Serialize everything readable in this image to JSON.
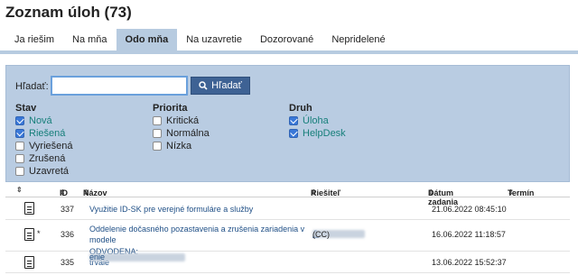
{
  "page": {
    "title": "Zoznam úloh (73)"
  },
  "tabs": [
    {
      "label": "Ja riešim",
      "active": false
    },
    {
      "label": "Na mňa",
      "active": false
    },
    {
      "label": "Odo mňa",
      "active": true
    },
    {
      "label": "Na uzavretie",
      "active": false
    },
    {
      "label": "Dozorované",
      "active": false
    },
    {
      "label": "Nepridelené",
      "active": false
    }
  ],
  "filter": {
    "search_label": "Hľadať:",
    "search_value": "",
    "search_button": "Hľadať",
    "accent": "#3e6294",
    "groups": {
      "stav": {
        "title": "Stav",
        "options": [
          {
            "label": "Nová",
            "checked": true
          },
          {
            "label": "Riešená",
            "checked": true
          },
          {
            "label": "Vyriešená",
            "checked": false
          },
          {
            "label": "Zrušená",
            "checked": false
          },
          {
            "label": "Uzavretá",
            "checked": false
          }
        ]
      },
      "priorita": {
        "title": "Priorita",
        "options": [
          {
            "label": "Kritická",
            "checked": false
          },
          {
            "label": "Normálna",
            "checked": false
          },
          {
            "label": "Nízka",
            "checked": false
          }
        ]
      },
      "druh": {
        "title": "Druh",
        "options": [
          {
            "label": "Úloha",
            "checked": true
          },
          {
            "label": "HelpDesk",
            "checked": true
          }
        ]
      }
    }
  },
  "table": {
    "columns": {
      "id": "ID",
      "name": "Názov",
      "solver": "Riešiteľ",
      "date": "Dátum zadania",
      "deadline": "Termín"
    },
    "rows": [
      {
        "id": "337",
        "name": "Využitie ID-SK pre verejné formuláre a služby",
        "solver": "",
        "date": "21.06.2022 08:45:10",
        "starred": false
      },
      {
        "id": "336",
        "name": "Oddelenie dočasného pozastavenia a zrušenia zariadenia v modele",
        "solver": "(CC)",
        "date": "16.06.2022 11:18:57",
        "starred": true
      },
      {
        "id": "335",
        "name": "ODVODENA: trvalé",
        "name_end": "enie",
        "solver": "",
        "date": "13.06.2022 15:52:37",
        "starred": false
      }
    ]
  }
}
